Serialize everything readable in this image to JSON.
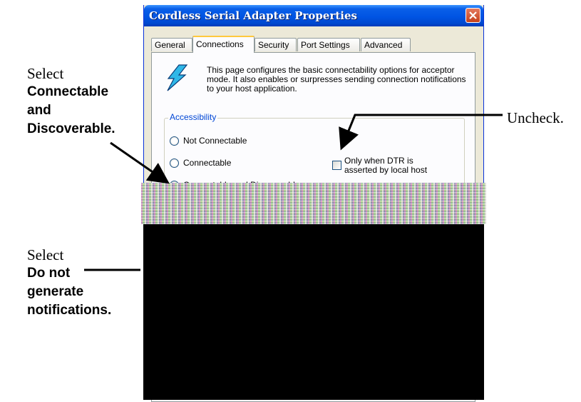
{
  "window": {
    "title": "Cordless Serial Adapter Properties"
  },
  "tabs": [
    "General",
    "Connections",
    "Security",
    "Port Settings",
    "Advanced"
  ],
  "intro_text": "This page configures the basic connectability options for acceptor mode. It also enables or surpresses sending connection notifications to your host application.",
  "accessibility": {
    "label": "Accessibility",
    "options": [
      {
        "label": "Not Connectable",
        "checked": false
      },
      {
        "label": "Connectable",
        "checked": false
      },
      {
        "label": "Connectable and Discoverable",
        "checked": true
      }
    ],
    "dtr_checkbox": {
      "line1": "Only when DTR is",
      "line2": "asserted by local host",
      "checked": false
    }
  },
  "annotations": {
    "left_top": {
      "line1": "Select",
      "line2": "Connectable",
      "line3": "and",
      "line4": "Discoverable."
    },
    "right": "Uncheck.",
    "left_bottom": {
      "line1": "Select",
      "line2": "Do not",
      "line3": "generate",
      "line4": "notifications."
    }
  },
  "icons": {
    "lightning": "lightning-icon",
    "close": "close-icon"
  },
  "colors": {
    "title_blue": "#0054e3",
    "tab_highlight": "#ffc83c",
    "group_label": "#0046d5"
  }
}
